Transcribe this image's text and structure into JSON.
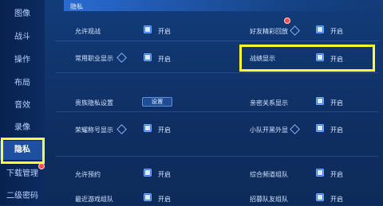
{
  "sidebar": {
    "items": [
      {
        "label": "图像"
      },
      {
        "label": "战斗"
      },
      {
        "label": "操作"
      },
      {
        "label": "布局"
      },
      {
        "label": "音效"
      },
      {
        "label": "录像"
      },
      {
        "label": "隐私"
      },
      {
        "label": "下载管理"
      },
      {
        "label": "二级密码"
      }
    ]
  },
  "section": {
    "title": "隐私"
  },
  "toggle_on_label": "开启",
  "settings": {
    "r1": {
      "left": "允许观战",
      "right": "好友精彩回放"
    },
    "r2": {
      "left": "常用职业显示",
      "right": "战绩显示"
    },
    "r3": {
      "left": "贵族隐私设置",
      "left_button": "设置",
      "right": "亲密关系显示"
    },
    "r4": {
      "left": "荣耀称号显示",
      "right": "小队开黑外显"
    },
    "r5": {
      "left": "允许预约",
      "right": "综合频道组队"
    },
    "r6": {
      "left": "最近游戏组队",
      "right": "招募队友组队"
    }
  }
}
